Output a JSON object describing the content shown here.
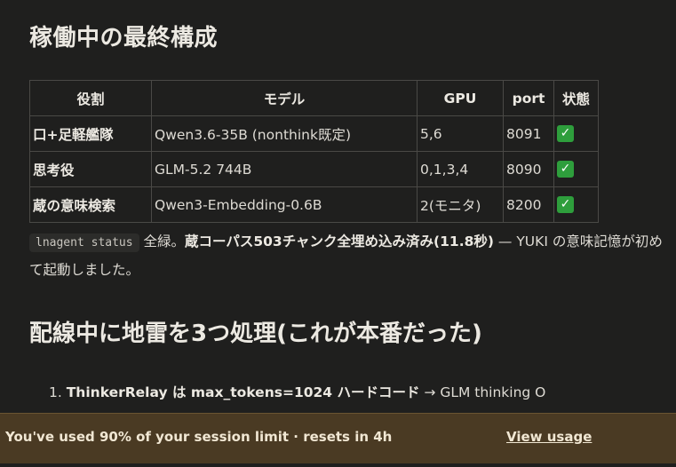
{
  "heading_config": "稼働中の最終構成",
  "table": {
    "headers": [
      "役割",
      "モデル",
      "GPU",
      "port",
      "状態"
    ],
    "rows": [
      {
        "role": "口+足軽艦隊",
        "model": "Qwen3.6-35B (nonthink既定)",
        "gpu": "5,6",
        "port": "8091",
        "status": "✓"
      },
      {
        "role": "思考役",
        "model": "GLM-5.2 744B",
        "gpu": "0,1,3,4",
        "port": "8090",
        "status": "✓"
      },
      {
        "role": "蔵の意味検索",
        "model": "Qwen3-Embedding-0.6B",
        "gpu": "2(モニタ)",
        "port": "8200",
        "status": "✓"
      }
    ]
  },
  "paragraph": {
    "code": "lnagent status",
    "text1": " 全緑。",
    "bold": "蔵コーパス503チャンク全埋め込み済み(11.8秒)",
    "text2": " — YUKI の意味記憶が初めて起動しました。"
  },
  "heading_wiring": "配線中に地雷を3つ処理(これが本番だった)",
  "list": {
    "number": "1.",
    "bold": "ThinkerRelay は max_tokens=1024 ハードコード",
    "text": " → GLM thinking O"
  },
  "banner": {
    "message": "You've used 90% of your session limit · resets in 4h",
    "link": "View usage"
  },
  "colors": {
    "background": "#1f1f1e",
    "banner": "#4a3a23",
    "check": "#2e9e3c"
  }
}
